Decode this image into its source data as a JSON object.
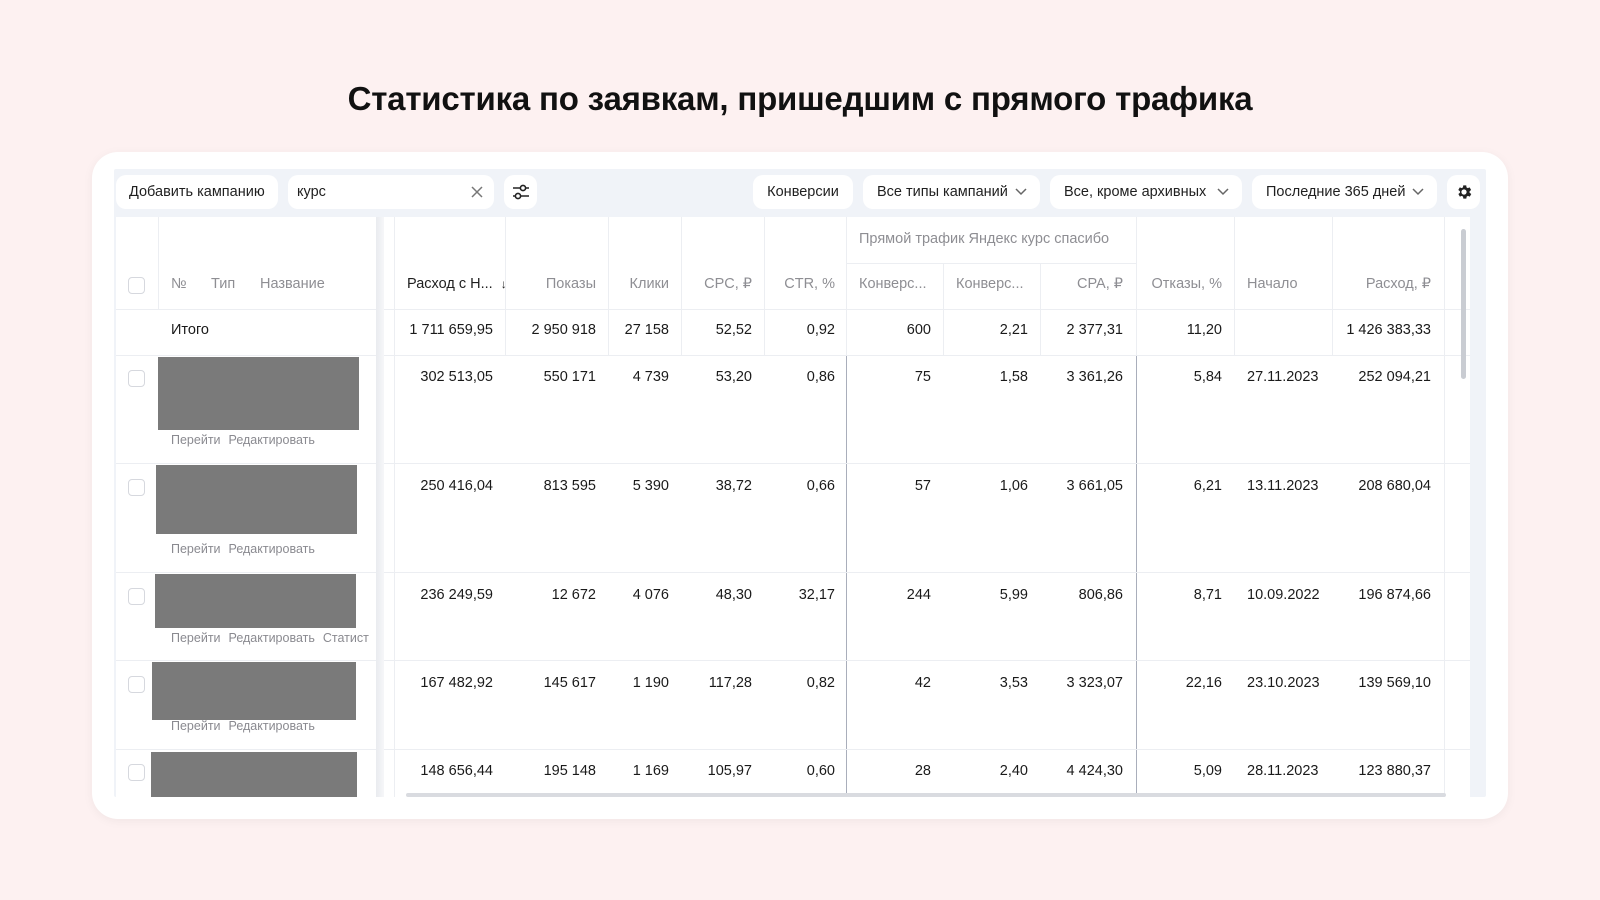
{
  "page": {
    "title": "Статистика по заявкам, пришедшим с прямого трафика"
  },
  "toolbar": {
    "add_campaign": "Добавить кампанию",
    "search_value": "курс",
    "conversions": "Конверсии",
    "campaign_types": "Все типы кампаний",
    "archive_filter": "Все, кроме архивных",
    "period": "Последние 365 дней"
  },
  "table": {
    "group_header": "Прямой трафик Яндекс курс спасибо",
    "columns": {
      "num": "№",
      "type": "Тип",
      "name": "Название",
      "spend_vat": "Расход с Н...",
      "impressions": "Показы",
      "clicks": "Клики",
      "cpc": "CPC, ₽",
      "ctr": "CTR, %",
      "conversions": "Конверс...",
      "conv_rate": "Конверс...",
      "cpa": "CPA, ₽",
      "bounces": "Отказы, %",
      "start": "Начало",
      "spend": "Расход, ₽"
    },
    "sort_indicator": "↓",
    "total": {
      "label": "Итого",
      "spend_vat": "1 711 659,95",
      "impressions": "2 950 918",
      "clicks": "27 158",
      "cpc": "52,52",
      "ctr": "0,92",
      "conversions": "600",
      "conv_rate": "2,21",
      "cpa": "2 377,31",
      "bounces": "11,20",
      "start": "",
      "spend": "1 426 383,33"
    },
    "rows": [
      {
        "spend_vat": "302 513,05",
        "impressions": "550 171",
        "clicks": "4 739",
        "cpc": "53,20",
        "ctr": "0,86",
        "conversions": "75",
        "conv_rate": "1,58",
        "cpa": "3 361,26",
        "bounces": "5,84",
        "start": "27.11.2023",
        "spend": "252 094,21",
        "link_go": "Перейти",
        "link_edit": "Редактировать",
        "link_stat": ""
      },
      {
        "spend_vat": "250 416,04",
        "impressions": "813 595",
        "clicks": "5 390",
        "cpc": "38,72",
        "ctr": "0,66",
        "conversions": "57",
        "conv_rate": "1,06",
        "cpa": "3 661,05",
        "bounces": "6,21",
        "start": "13.11.2023",
        "spend": "208 680,04",
        "link_go": "Перейти",
        "link_edit": "Редактировать",
        "link_stat": ""
      },
      {
        "spend_vat": "236 249,59",
        "impressions": "12 672",
        "clicks": "4 076",
        "cpc": "48,30",
        "ctr": "32,17",
        "conversions": "244",
        "conv_rate": "5,99",
        "cpa": "806,86",
        "bounces": "8,71",
        "start": "10.09.2022",
        "spend": "196 874,66",
        "link_go": "Перейти",
        "link_edit": "Редактировать",
        "link_stat": "Статист"
      },
      {
        "spend_vat": "167 482,92",
        "impressions": "145 617",
        "clicks": "1 190",
        "cpc": "117,28",
        "ctr": "0,82",
        "conversions": "42",
        "conv_rate": "3,53",
        "cpa": "3 323,07",
        "bounces": "22,16",
        "start": "23.10.2023",
        "spend": "139 569,10",
        "link_go": "Перейти",
        "link_edit": "Редактировать",
        "link_stat": ""
      },
      {
        "spend_vat": "148 656,44",
        "impressions": "195 148",
        "clicks": "1 169",
        "cpc": "105,97",
        "ctr": "0,60",
        "conversions": "28",
        "conv_rate": "2,40",
        "cpa": "4 424,30",
        "bounces": "5,09",
        "start": "28.11.2023",
        "spend": "123 880,37",
        "link_go": "",
        "link_edit": "",
        "link_stat": ""
      }
    ]
  }
}
